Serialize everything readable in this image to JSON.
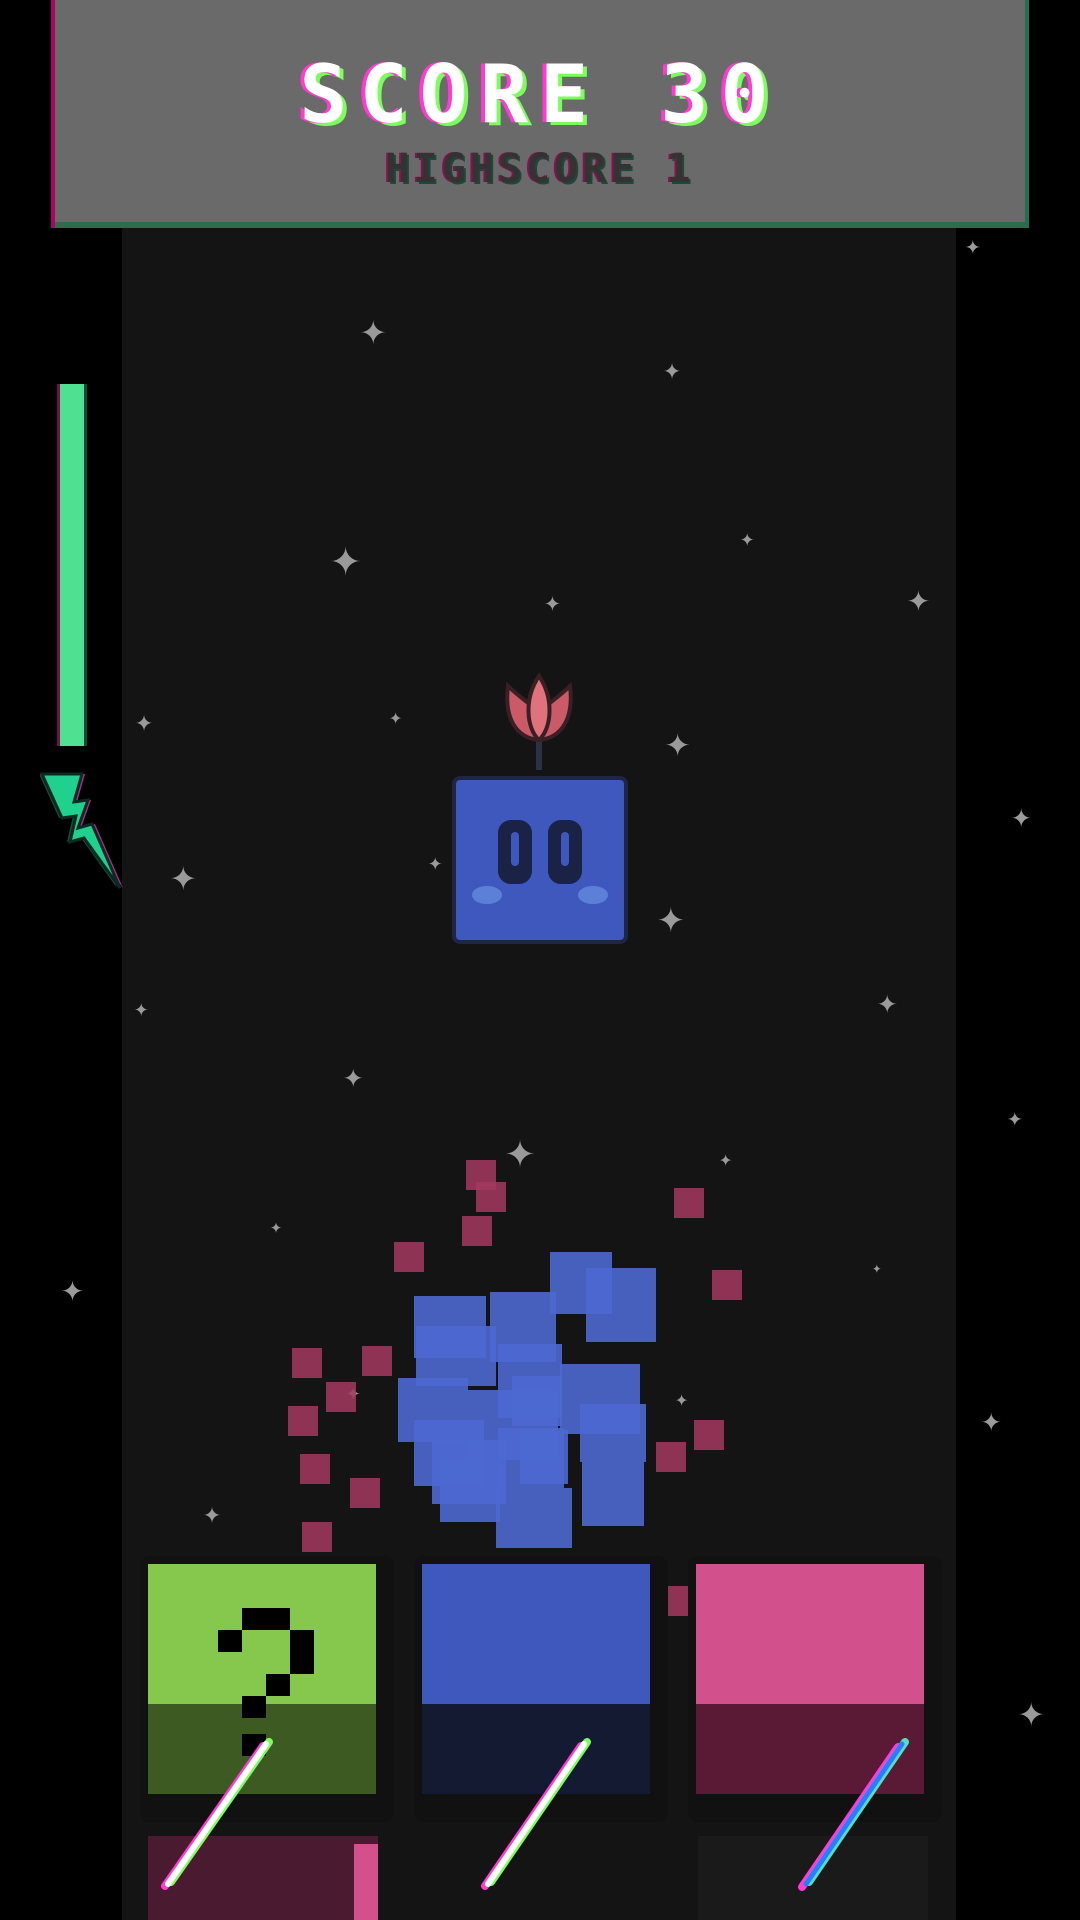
{
  "hud": {
    "score_text": "SCORE 30",
    "highscore_text": "HIGHSCORE 1"
  },
  "energy": {
    "level": 1.0,
    "color": "#4fe091",
    "icon": "lightning-bolt-icon"
  },
  "falling_block": {
    "color": "blue",
    "hex": "#3f58be",
    "decoration": "flower-sprout-icon"
  },
  "slots": [
    {
      "color": "green",
      "hex": "#86c84e",
      "symbol": "question-mark-icon"
    },
    {
      "color": "blue",
      "hex": "#3f58be",
      "symbol": ""
    },
    {
      "color": "pink",
      "hex": "#d2508c",
      "symbol": ""
    }
  ],
  "colors": {
    "background": "#000000",
    "playfield": "#141414",
    "accent_pink": "#ff3bd1",
    "accent_green": "#7bff5a"
  }
}
